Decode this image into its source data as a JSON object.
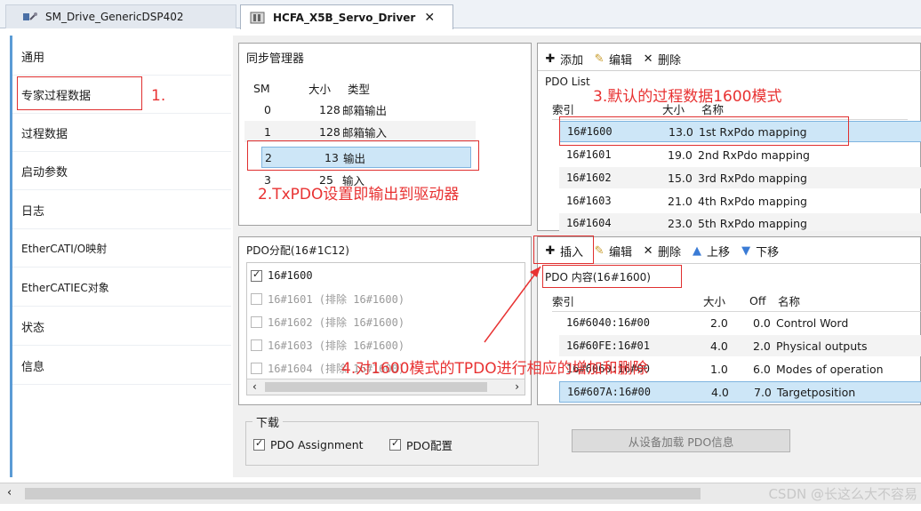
{
  "tabs": [
    {
      "label": "SM_Drive_GenericDSP402",
      "active": false
    },
    {
      "label": "HCFA_X5B_Servo_Driver",
      "active": true,
      "close": "x"
    }
  ],
  "sidebar": {
    "items": [
      {
        "label": "通用"
      },
      {
        "label": "专家过程数据"
      },
      {
        "label": "过程数据"
      },
      {
        "label": "启动参数"
      },
      {
        "label": "日志"
      },
      {
        "label": "EtherCATI/O映射"
      },
      {
        "label": "EtherCATIEC对象"
      },
      {
        "label": "状态"
      },
      {
        "label": "信息"
      }
    ]
  },
  "sync_manager": {
    "title": "同步管理器",
    "headers": {
      "sm": "SM",
      "size": "大小",
      "type": "类型"
    },
    "rows": [
      {
        "sm": "0",
        "size": "128",
        "type": "邮箱输出"
      },
      {
        "sm": "1",
        "size": "128",
        "type": "邮箱输入"
      },
      {
        "sm": "2",
        "size": "13",
        "type": "输出"
      },
      {
        "sm": "3",
        "size": "25",
        "type": "输入"
      }
    ]
  },
  "pdo_list": {
    "toolbar": {
      "add": "添加",
      "edit": "编辑",
      "delete": "删除"
    },
    "title": "PDO List",
    "headers": {
      "index": "索引",
      "size": "大小",
      "name": "名称"
    },
    "rows": [
      {
        "index": "16#1600",
        "size": "13.0",
        "name": "1st RxPdo mapping"
      },
      {
        "index": "16#1601",
        "size": "19.0",
        "name": "2nd RxPdo mapping"
      },
      {
        "index": "16#1602",
        "size": "15.0",
        "name": "3rd RxPdo mapping"
      },
      {
        "index": "16#1603",
        "size": "21.0",
        "name": "4th RxPdo mapping"
      },
      {
        "index": "16#1604",
        "size": "23.0",
        "name": "5th RxPdo mapping"
      }
    ]
  },
  "pdo_assign": {
    "title": "PDO分配(16#1C12)",
    "items": [
      {
        "label": "16#1600",
        "checked": true,
        "enabled": true
      },
      {
        "label": "16#1601 (排除 16#1600)",
        "checked": false,
        "enabled": false
      },
      {
        "label": "16#1602 (排除 16#1600)",
        "checked": false,
        "enabled": false
      },
      {
        "label": "16#1603 (排除 16#1600)",
        "checked": false,
        "enabled": false
      },
      {
        "label": "16#1604 (排除 16#1600)",
        "checked": false,
        "enabled": false
      }
    ]
  },
  "pdo_content": {
    "toolbar": {
      "insert": "插入",
      "edit": "编辑",
      "delete": "删除",
      "up": "上移",
      "down": "下移"
    },
    "title": "PDO 内容(16#1600)",
    "headers": {
      "index": "索引",
      "size": "大小",
      "off": "Off",
      "name": "名称"
    },
    "rows": [
      {
        "index": "16#6040:16#00",
        "size": "2.0",
        "off": "0.0",
        "name": "Control Word"
      },
      {
        "index": "16#60FE:16#01",
        "size": "4.0",
        "off": "2.0",
        "name": "Physical outputs"
      },
      {
        "index": "16#6060:16#00",
        "size": "1.0",
        "off": "6.0",
        "name": "Modes of operation"
      },
      {
        "index": "16#607A:16#00",
        "size": "4.0",
        "off": "7.0",
        "name": "Targetposition"
      }
    ]
  },
  "download": {
    "title": "下载",
    "pdo_assignment": "PDO Assignment",
    "pdo_config": "PDO配置",
    "load_button": "从设备加载 PDO信息"
  },
  "annotations": {
    "a1": "1.",
    "a2": "2.TxPDO设置即输出到驱动器",
    "a3": "3.默认的过程数据1600模式",
    "a4": "4.对1600模式的TPDO进行相应的增加和删除"
  },
  "watermark": "CSDN @长这么大不容易",
  "colors": {
    "annotation": "#e83232",
    "selection": "#cde6f7",
    "sidebar_accent": "#5b9bd5"
  }
}
